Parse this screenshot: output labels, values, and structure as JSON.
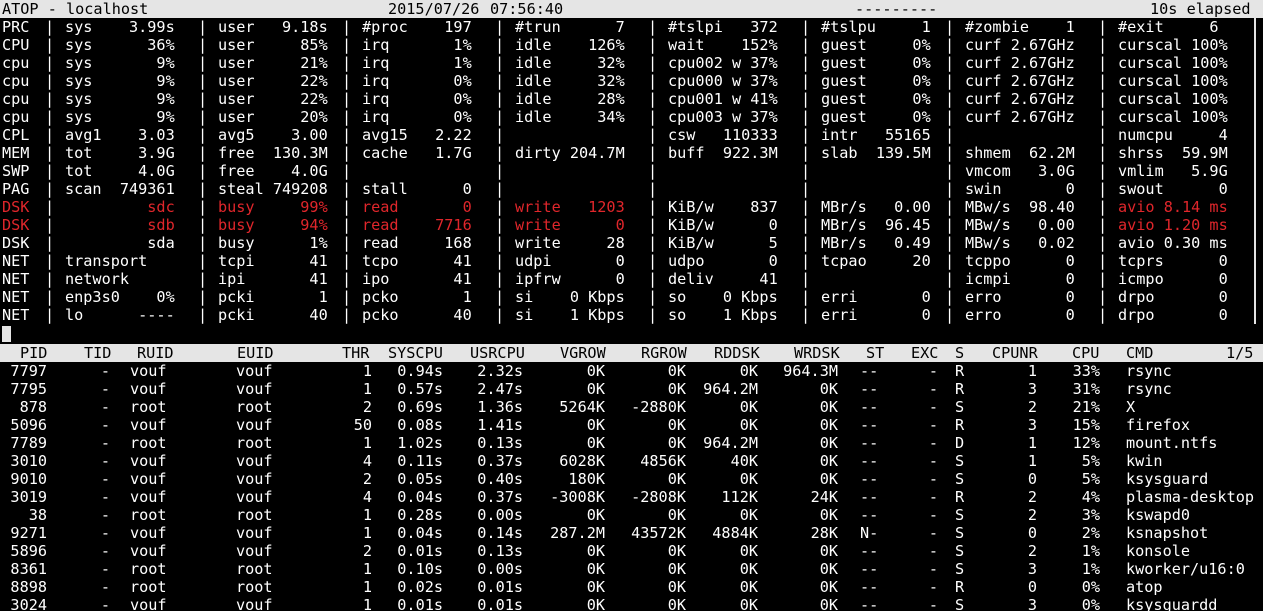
{
  "colors": {
    "background": "#000000",
    "foreground": "#ffffff",
    "bar_background": "#e5e5e5",
    "bar_foreground": "#000000",
    "critical": "#e0262b"
  },
  "header": {
    "title": "ATOP - localhost",
    "date": "2015/07/26",
    "time": "07:56:40",
    "dashes": "---------",
    "elapsed": "10s elapsed"
  },
  "system": [
    {
      "label": "PRC",
      "cells": [
        "sys    3.99s",
        "user   9.18s",
        "#proc    197",
        "#trun      7",
        "#tslpi   372",
        "#tslpu     1",
        "#zombie    1",
        "#exit     6"
      ],
      "red": [
        false,
        false,
        false,
        false,
        false,
        false,
        false,
        false
      ]
    },
    {
      "label": "CPU",
      "cells": [
        "sys      36%",
        "user     85%",
        "irq       1%",
        "idle    126%",
        "wait    152%",
        "guest     0%",
        "curf 2.67GHz",
        "curscal 100%"
      ],
      "red": [
        false,
        false,
        false,
        false,
        false,
        false,
        false,
        false
      ]
    },
    {
      "label": "cpu",
      "cells": [
        "sys       9%",
        "user     21%",
        "irq       1%",
        "idle     32%",
        "cpu002 w 37%",
        "guest     0%",
        "curf 2.67GHz",
        "curscal 100%"
      ],
      "red": [
        false,
        false,
        false,
        false,
        false,
        false,
        false,
        false
      ]
    },
    {
      "label": "cpu",
      "cells": [
        "sys       9%",
        "user     22%",
        "irq       0%",
        "idle     32%",
        "cpu000 w 37%",
        "guest     0%",
        "curf 2.67GHz",
        "curscal 100%"
      ],
      "red": [
        false,
        false,
        false,
        false,
        false,
        false,
        false,
        false
      ]
    },
    {
      "label": "cpu",
      "cells": [
        "sys       9%",
        "user     22%",
        "irq       0%",
        "idle     28%",
        "cpu001 w 41%",
        "guest     0%",
        "curf 2.67GHz",
        "curscal 100%"
      ],
      "red": [
        false,
        false,
        false,
        false,
        false,
        false,
        false,
        false
      ]
    },
    {
      "label": "cpu",
      "cells": [
        "sys       9%",
        "user     20%",
        "irq       0%",
        "idle     34%",
        "cpu003 w 37%",
        "guest     0%",
        "curf 2.67GHz",
        "curscal 100%"
      ],
      "red": [
        false,
        false,
        false,
        false,
        false,
        false,
        false,
        false
      ]
    },
    {
      "label": "CPL",
      "cells": [
        "avg1    3.03",
        "avg5    3.00",
        "avg15   2.22",
        "",
        "csw   110333",
        "intr   55165",
        "",
        "numcpu     4"
      ],
      "red": [
        false,
        false,
        false,
        false,
        false,
        false,
        false,
        false
      ]
    },
    {
      "label": "MEM",
      "cells": [
        "tot     3.9G",
        "free  130.3M",
        "cache   1.7G",
        "dirty 204.7M",
        "buff  922.3M",
        "slab  139.5M",
        "shmem  62.2M",
        "shrss  59.9M"
      ],
      "red": [
        false,
        false,
        false,
        false,
        false,
        false,
        false,
        false
      ]
    },
    {
      "label": "SWP",
      "cells": [
        "tot     4.0G",
        "free    4.0G",
        "",
        "",
        "",
        "",
        "vmcom   3.0G",
        "vmlim   5.9G"
      ],
      "red": [
        false,
        false,
        false,
        false,
        false,
        false,
        false,
        false
      ]
    },
    {
      "label": "PAG",
      "cells": [
        "scan  749361",
        "steal 749208",
        "stall      0",
        "",
        "",
        "",
        "swin       0",
        "swout      0"
      ],
      "red": [
        false,
        false,
        false,
        false,
        false,
        false,
        false,
        false
      ]
    },
    {
      "label": "DSK",
      "cells": [
        "         sdc",
        "busy     99%",
        "read       0",
        "write   1203",
        "KiB/w    837",
        "MBr/s   0.00",
        "MBw/s  98.40",
        "avio 8.14 ms"
      ],
      "red": [
        true,
        true,
        true,
        true,
        false,
        false,
        false,
        true
      ],
      "label_red": true
    },
    {
      "label": "DSK",
      "cells": [
        "         sdb",
        "busy     94%",
        "read    7716",
        "write      0",
        "KiB/w      0",
        "MBr/s  96.45",
        "MBw/s   0.00",
        "avio 1.20 ms"
      ],
      "red": [
        true,
        true,
        true,
        true,
        false,
        false,
        false,
        true
      ],
      "label_red": true
    },
    {
      "label": "DSK",
      "cells": [
        "         sda",
        "busy      1%",
        "read     168",
        "write     28",
        "KiB/w      5",
        "MBr/s   0.49",
        "MBw/s   0.02",
        "avio 0.30 ms"
      ],
      "red": [
        false,
        false,
        false,
        false,
        false,
        false,
        false,
        false
      ]
    },
    {
      "label": "NET",
      "cells": [
        "transport   ",
        "tcpi      41",
        "tcpo      41",
        "udpi       0",
        "udpo       0",
        "tcpao     20",
        "tcppo      0",
        "tcprs      0"
      ],
      "red": [
        false,
        false,
        false,
        false,
        false,
        false,
        false,
        false
      ]
    },
    {
      "label": "NET",
      "cells": [
        "network     ",
        "ipi       41",
        "ipo       41",
        "ipfrw      0",
        "deliv     41",
        "",
        "icmpi      0",
        "icmpo      0"
      ],
      "red": [
        false,
        false,
        false,
        false,
        false,
        false,
        false,
        false
      ]
    },
    {
      "label": "NET",
      "cells": [
        "enp3s0    0%",
        "pcki       1",
        "pcko       1",
        "si    0 Kbps",
        "so    0 Kbps",
        "erri       0",
        "erro       0",
        "drpo       0"
      ],
      "red": [
        false,
        false,
        false,
        false,
        false,
        false,
        false,
        false
      ]
    },
    {
      "label": "NET",
      "cells": [
        "lo      ----",
        "pcki      40",
        "pcko      40",
        "si    1 Kbps",
        "so    1 Kbps",
        "erri       0",
        "erro       0",
        "drpo       0"
      ],
      "red": [
        false,
        false,
        false,
        false,
        false,
        false,
        false,
        false
      ]
    }
  ],
  "process_header": {
    "columns": [
      "PID",
      "TID",
      "RUID",
      "EUID",
      "THR",
      "SYSCPU",
      "USRCPU",
      "VGROW",
      "RGROW",
      "RDDSK",
      "WRDSK",
      "ST",
      "EXC",
      "S",
      "CPUNR",
      "CPU",
      "CMD"
    ],
    "page": "1/5"
  },
  "processes": [
    [
      "7797",
      "-",
      "vouf",
      "vouf",
      "1",
      "0.94s",
      "2.32s",
      "0K",
      "0K",
      "0K",
      "964.3M",
      "--",
      "-",
      "R",
      "1",
      "33%",
      "rsync"
    ],
    [
      "7795",
      "-",
      "vouf",
      "vouf",
      "1",
      "0.57s",
      "2.47s",
      "0K",
      "0K",
      "964.2M",
      "0K",
      "--",
      "-",
      "R",
      "3",
      "31%",
      "rsync"
    ],
    [
      "878",
      "-",
      "root",
      "root",
      "2",
      "0.69s",
      "1.36s",
      "5264K",
      "-2880K",
      "0K",
      "0K",
      "--",
      "-",
      "S",
      "2",
      "21%",
      "X"
    ],
    [
      "5096",
      "-",
      "vouf",
      "vouf",
      "50",
      "0.08s",
      "1.41s",
      "0K",
      "0K",
      "0K",
      "0K",
      "--",
      "-",
      "R",
      "3",
      "15%",
      "firefox"
    ],
    [
      "7789",
      "-",
      "root",
      "root",
      "1",
      "1.02s",
      "0.13s",
      "0K",
      "0K",
      "964.2M",
      "0K",
      "--",
      "-",
      "D",
      "1",
      "12%",
      "mount.ntfs"
    ],
    [
      "3010",
      "-",
      "vouf",
      "vouf",
      "4",
      "0.11s",
      "0.37s",
      "6028K",
      "4856K",
      "40K",
      "0K",
      "--",
      "-",
      "S",
      "1",
      "5%",
      "kwin"
    ],
    [
      "9010",
      "-",
      "vouf",
      "vouf",
      "2",
      "0.05s",
      "0.40s",
      "180K",
      "0K",
      "0K",
      "0K",
      "--",
      "-",
      "S",
      "0",
      "5%",
      "ksysguard"
    ],
    [
      "3019",
      "-",
      "vouf",
      "vouf",
      "4",
      "0.04s",
      "0.37s",
      "-3008K",
      "-2808K",
      "112K",
      "24K",
      "--",
      "-",
      "R",
      "2",
      "4%",
      "plasma-desktop"
    ],
    [
      "38",
      "-",
      "root",
      "root",
      "1",
      "0.28s",
      "0.00s",
      "0K",
      "0K",
      "0K",
      "0K",
      "--",
      "-",
      "S",
      "2",
      "3%",
      "kswapd0"
    ],
    [
      "9271",
      "-",
      "vouf",
      "vouf",
      "1",
      "0.04s",
      "0.14s",
      "287.2M",
      "43572K",
      "4884K",
      "28K",
      "N-",
      "-",
      "S",
      "0",
      "2%",
      "ksnapshot"
    ],
    [
      "5896",
      "-",
      "vouf",
      "vouf",
      "2",
      "0.01s",
      "0.13s",
      "0K",
      "0K",
      "0K",
      "0K",
      "--",
      "-",
      "S",
      "2",
      "1%",
      "konsole"
    ],
    [
      "8361",
      "-",
      "root",
      "root",
      "1",
      "0.10s",
      "0.00s",
      "0K",
      "0K",
      "0K",
      "0K",
      "--",
      "-",
      "S",
      "3",
      "1%",
      "kworker/u16:0"
    ],
    [
      "8898",
      "-",
      "root",
      "root",
      "1",
      "0.02s",
      "0.01s",
      "0K",
      "0K",
      "0K",
      "0K",
      "--",
      "-",
      "R",
      "0",
      "0%",
      "atop"
    ],
    [
      "3024",
      "-",
      "vouf",
      "vouf",
      "1",
      "0.01s",
      "0.01s",
      "0K",
      "0K",
      "0K",
      "0K",
      "--",
      "-",
      "S",
      "3",
      "0%",
      "ksysguardd"
    ]
  ]
}
